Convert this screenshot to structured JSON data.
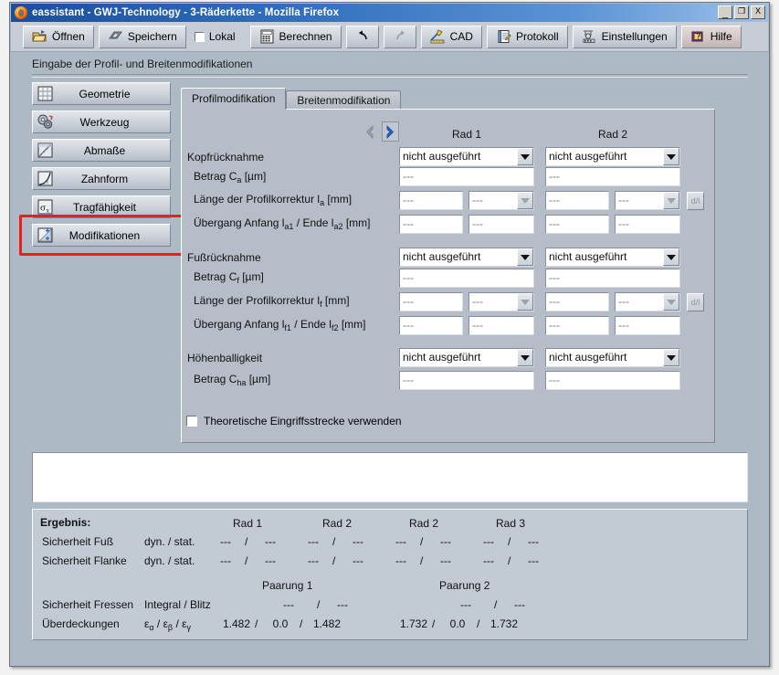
{
  "window": {
    "title": "eassistant - GWJ-Technology - 3-Räderkette - Mozilla Firefox",
    "minimize_label": "_",
    "maximize_label": "❐",
    "close_label": "X",
    "app_icon": "firefox-icon"
  },
  "toolbar": {
    "open_label": "Öffnen",
    "save_label": "Speichern",
    "local_label": "Lokal",
    "calculate_label": "Berechnen",
    "undo_label": "",
    "redo_label": "",
    "cad_label": "CAD",
    "protocol_label": "Protokoll",
    "settings_label": "Einstellungen",
    "help_label": "Hilfe"
  },
  "page": {
    "subtitle": "Eingabe der Profil- und Breitenmodifikationen"
  },
  "sidebar": {
    "items": [
      {
        "label": "Geometrie",
        "icon": "grid-icon",
        "active": false
      },
      {
        "label": "Werkzeug",
        "icon": "gears-icon",
        "active": false
      },
      {
        "label": "Abmaße",
        "icon": "ruler-icon",
        "active": false
      },
      {
        "label": "Zahnform",
        "icon": "curve-icon",
        "active": false
      },
      {
        "label": "Tragfähigkeit",
        "icon": "sigma-icon",
        "active": false
      },
      {
        "label": "Modifikationen",
        "icon": "modify-icon",
        "active": true
      }
    ]
  },
  "tabs": [
    {
      "label": "Profilmodifikation",
      "active": true
    },
    {
      "label": "Breitenmodifikation",
      "active": false
    }
  ],
  "nav_arrows": {
    "prev_label": "◀",
    "next_label": "▶"
  },
  "columns": {
    "col1": "Rad 1",
    "col2": "Rad 2"
  },
  "form": {
    "placeholder": "---",
    "sections": [
      {
        "title": "Kopfrücknahme",
        "select_value": "nicht ausgeführt",
        "rows": [
          {
            "label_html": "Betrag C<sub>a</sub> [µm]"
          },
          {
            "label_html": "Länge der Profilkorrektur l<sub>a</sub> [mm]"
          },
          {
            "label_html": "Übergang Anfang l<sub>a1</sub> / Ende l<sub>a2</sub> [mm]"
          }
        ]
      },
      {
        "title": "Fußrücknahme",
        "select_value": "nicht ausgeführt",
        "rows": [
          {
            "label_html": "Betrag C<sub>f</sub> [µm]"
          },
          {
            "label_html": "Länge der Profilkorrektur l<sub>f</sub> [mm]"
          },
          {
            "label_html": "Übergang Anfang l<sub>f1</sub> / Ende l<sub>f2</sub> [mm]"
          }
        ]
      },
      {
        "title": "Höhenballigkeit",
        "select_value": "nicht ausgeführt",
        "rows": [
          {
            "label_html": "Betrag C<sub>ha</sub> [µm]"
          }
        ]
      }
    ],
    "dl_button_label": "d/l",
    "checkbox_label": "Theoretische Eingriffsstrecke verwenden",
    "checkbox_checked": false
  },
  "results": {
    "heading": "Ergebnis:",
    "wheel_headers": [
      "Rad 1",
      "Rad 2",
      "Rad 2",
      "Rad 3"
    ],
    "rows": [
      {
        "label": "Sicherheit Fuß",
        "unit": "dyn. / stat.",
        "values": [
          [
            "---",
            "---"
          ],
          [
            "---",
            "---"
          ],
          [
            "---",
            "---"
          ],
          [
            "---",
            "---"
          ]
        ]
      },
      {
        "label": "Sicherheit Flanke",
        "unit": "dyn. / stat.",
        "values": [
          [
            "---",
            "---"
          ],
          [
            "---",
            "---"
          ],
          [
            "---",
            "---"
          ],
          [
            "---",
            "---"
          ]
        ]
      }
    ],
    "pair_headers": [
      "Paarung 1",
      "Paarung 2"
    ],
    "pair_rows": [
      {
        "label": "Sicherheit Fressen",
        "unit_html": "Integral / Blitz",
        "pair1": [
          "---",
          "---"
        ],
        "pair2": [
          "---",
          "---"
        ]
      },
      {
        "label": "Überdeckungen",
        "unit_html": "ε<sub>α</sub> / ε<sub>β</sub> / ε<sub>γ</sub>",
        "pair1": [
          "1.482",
          "0.0",
          "1.482"
        ],
        "pair2": [
          "1.732",
          "0.0",
          "1.732"
        ]
      }
    ],
    "separator": "/"
  },
  "colors": {
    "accent": "#1a4f9c",
    "panel": "#b6bdc8",
    "toolbar": "#c7cdd6",
    "highlight": "#f51b1b",
    "results_panel": "#c2cad4"
  }
}
